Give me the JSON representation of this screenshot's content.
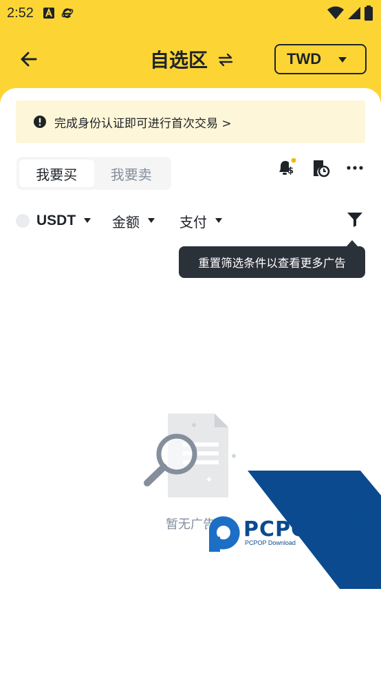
{
  "status_bar": {
    "time": "2:52"
  },
  "header": {
    "title": "自选区",
    "currency": "TWD"
  },
  "notice": {
    "text": "完成身份认证即可进行首次交易 >"
  },
  "trade_toggle": {
    "buy_label": "我要买",
    "sell_label": "我要卖",
    "active": "buy"
  },
  "filters": {
    "coin": "USDT",
    "amount": "金额",
    "payment": "支付"
  },
  "tooltip": {
    "text": "重置筛选条件以查看更多广告"
  },
  "empty_state": {
    "text": "暂无广告"
  },
  "watermark": {
    "brand": "PCPOP下载",
    "sub": "PCPOP Download"
  },
  "colors": {
    "brand_yellow": "#fcd535",
    "notice_bg": "#fef6d8",
    "tooltip_bg": "#2b3139",
    "notification_dot": "#f0b90b"
  },
  "icons": [
    "back-arrow-icon",
    "swap-icon",
    "chevron-down-icon",
    "info-icon",
    "bell-dollar-icon",
    "order-history-icon",
    "more-icon",
    "filter-icon",
    "empty-search-icon"
  ]
}
